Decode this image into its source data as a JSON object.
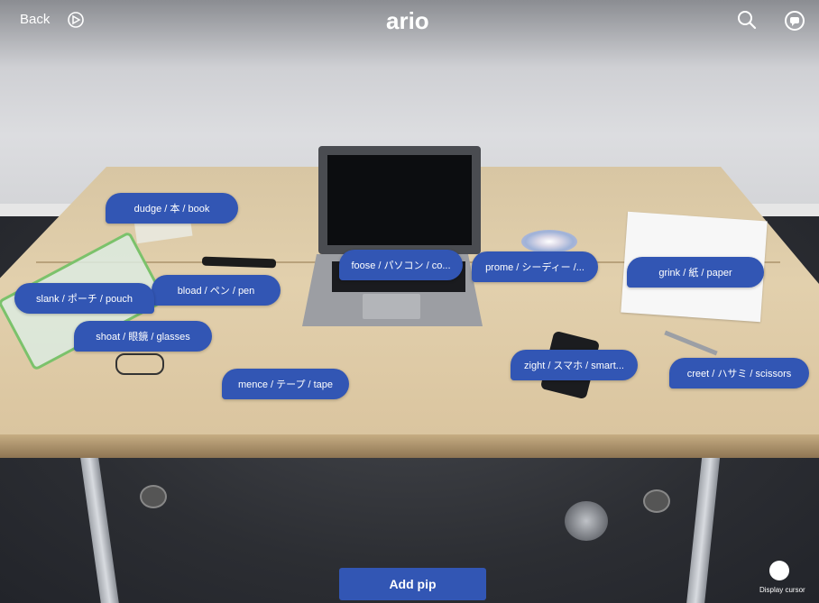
{
  "topbar": {
    "back_label": "Back",
    "logo": "ario",
    "icons": [
      "settings-icon",
      "search-icon",
      "chat-icon"
    ]
  },
  "pins": [
    {
      "label": "dudge / 本 / book"
    },
    {
      "label": "foose / パソコン / co..."
    },
    {
      "label": "prome / シーディー /..."
    },
    {
      "label": "grink / 紙 / paper"
    },
    {
      "label": "bload / ペン / pen"
    },
    {
      "label": "slank / ポーチ / pouch"
    },
    {
      "label": "shoat / 眼鏡 / glasses"
    },
    {
      "label": "mence / テープ / tape"
    },
    {
      "label": "zight / スマホ / smart..."
    },
    {
      "label": "creet / ハサミ / scissors"
    }
  ],
  "add_pip_label": "Add pip",
  "display_cursor_label": "Display cursor",
  "colors": {
    "pin": "#3256b4",
    "button": "#3256b4"
  }
}
